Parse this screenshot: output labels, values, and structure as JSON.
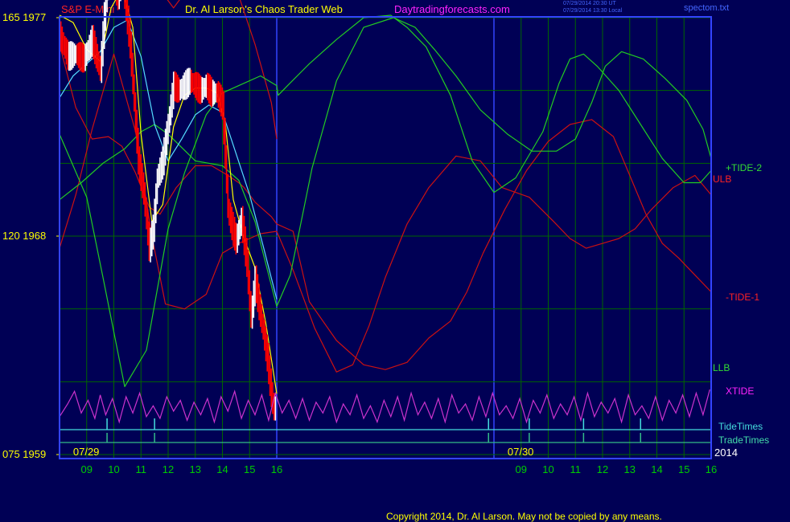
{
  "header": {
    "instrument": "S&P E-Mini",
    "site": "Dr. Al Larson's Chaos Trader Web",
    "url": "Daytradingforecasts.com",
    "stamp_utc": "07/29/2014 20:30 UT",
    "stamp_local": "07/29/2014 13:30 Local",
    "file": "spectom.txt"
  },
  "colors": {
    "background": "#000055",
    "frame": "#3344ff",
    "grid": "#006600",
    "price_up": "#ffffff",
    "price_down": "#ff0000",
    "fast_ma": "#ffff00",
    "slow_ma": "#55ddff",
    "tide_green": "#22cc22",
    "tide_red": "#cc1111",
    "xtide": "#cc33cc",
    "tidetimes": "#44dddd",
    "tradetimes": "#33bb88"
  },
  "labels": {
    "tide2": "+TIDE-2",
    "ulb": "ULB",
    "tide1": "-TIDE-1",
    "llb": "LLB",
    "xtide": "XTIDE",
    "tidetimes": "TideTimes",
    "tradetimes": "TradeTimes",
    "year": "2014",
    "date1": "07/29",
    "date2": "07/30"
  },
  "copyright": "Copyright 2014, Dr. Al Larson. May not be copied by any means.",
  "chart_data": {
    "type": "line",
    "y_axis_labels": [
      {
        "tide": "165",
        "price": "1977"
      },
      {
        "tide": "120",
        "price": "1968"
      },
      {
        "tide": "075",
        "price": "1959"
      }
    ],
    "ylim": [
      1959,
      1977
    ],
    "x_tick_labels": [
      "09",
      "10",
      "11",
      "12",
      "13",
      "14",
      "15",
      "16",
      "09",
      "10",
      "11",
      "12",
      "13",
      "14",
      "15",
      "16"
    ],
    "x_hours": [
      9,
      10,
      11,
      12,
      13,
      14,
      15,
      16,
      25,
      26,
      27,
      28,
      29,
      30,
      31,
      32
    ],
    "xlim": [
      8,
      32
    ],
    "date_labels": [
      {
        "text": "07/29",
        "hour": 8.5
      },
      {
        "text": "07/30",
        "hour": 24.5
      }
    ],
    "price_series": {
      "name": "S&P E-Mini",
      "hours": [
        8,
        8.3,
        8.6,
        8.9,
        9.2,
        9.5,
        9.7,
        9.85,
        10,
        10.15,
        10.3,
        10.45,
        10.6,
        10.75,
        10.9,
        11.1,
        11.3,
        11.45,
        11.6,
        11.8,
        12,
        12.2,
        12.4,
        12.6,
        12.8,
        13,
        13.2,
        13.4,
        13.6,
        13.8,
        14,
        14.1,
        14.2,
        14.35,
        14.5,
        14.7,
        14.9,
        15.05,
        15.2,
        15.35,
        15.5,
        15.65,
        15.8,
        15.9,
        16
      ],
      "values": [
        1976.3,
        1975.4,
        1975.5,
        1975.3,
        1976.1,
        1974.8,
        1977.8,
        1979.1,
        1978.5,
        1977.9,
        1978.7,
        1977.4,
        1975.9,
        1973.5,
        1971.1,
        1969.8,
        1967.5,
        1968.3,
        1970.4,
        1971.1,
        1972.6,
        1974.2,
        1974.0,
        1974.2,
        1974.4,
        1974.2,
        1974.0,
        1974.2,
        1973.9,
        1973.9,
        1973.4,
        1971.3,
        1969.1,
        1968.4,
        1967.8,
        1968.7,
        1966.9,
        1964.6,
        1966.2,
        1965.1,
        1964.1,
        1963.0,
        1961.5,
        1960.8,
        1961.2
      ]
    },
    "fast_ma": {
      "hours": [
        8,
        8.5,
        9,
        9.5,
        9.9,
        10.3,
        10.7,
        11,
        11.4,
        11.8,
        12.2,
        12.6,
        13,
        13.4,
        13.8,
        14.1,
        14.4,
        14.8,
        15.2,
        15.6,
        16
      ],
      "values": [
        1977.1,
        1976.8,
        1975.7,
        1975.2,
        1977.4,
        1978.2,
        1976.6,
        1972.2,
        1968.6,
        1969.3,
        1972.5,
        1973.8,
        1974.1,
        1974.1,
        1973.9,
        1972.7,
        1969.5,
        1967.9,
        1966.7,
        1964.4,
        1961.5
      ]
    },
    "slow_ma": {
      "hours": [
        8,
        8.5,
        9,
        9.5,
        10,
        10.5,
        11,
        11.5,
        12,
        12.5,
        13,
        13.5,
        14,
        14.5,
        15,
        15.5,
        16
      ],
      "values": [
        1973.7,
        1974.6,
        1975.1,
        1975.6,
        1976.6,
        1976.9,
        1975.4,
        1972.6,
        1971.1,
        1972.0,
        1973.0,
        1973.4,
        1973.1,
        1971.4,
        1969.7,
        1967.6,
        1965.4
      ]
    },
    "tide_green_1": {
      "hours": [
        8,
        9,
        9.6,
        10.4,
        11.2,
        12,
        12.6,
        13.4,
        14,
        14.6,
        15.4,
        16,
        16.05,
        16.4,
        17.2,
        18.2,
        19.2,
        20.2,
        20.8,
        21.5,
        22.4,
        23.2,
        24,
        24.8,
        25.8,
        26.4,
        26.8,
        27.3,
        27.8,
        28.6,
        29.4,
        30.2,
        31,
        31.6,
        32
      ],
      "values": [
        1972.2,
        1969.6,
        1966.3,
        1961.8,
        1963.3,
        1968.3,
        1970.6,
        1973.0,
        1973.9,
        1974.2,
        1974.6,
        1974.2,
        1973.8,
        1974.2,
        1975.1,
        1976.1,
        1977.0,
        1977.1,
        1976.6,
        1975.8,
        1973.8,
        1971.1,
        1969.8,
        1970.4,
        1972.3,
        1974.3,
        1975.3,
        1975.5,
        1975.0,
        1974.0,
        1972.6,
        1971.2,
        1970.2,
        1970.2,
        1970.7
      ]
    },
    "tide_green_2": {
      "hours": [
        8,
        8.8,
        9.6,
        10.4,
        11,
        11.5,
        12,
        13,
        14,
        14.6,
        15.2,
        16,
        16.5,
        17.3,
        18.2,
        19.2,
        20.3,
        21.1,
        21.8,
        22.6,
        23.5,
        24.5,
        25.4,
        26.3,
        27,
        27.6,
        28.1,
        28.7,
        29.5,
        30.3,
        31.1,
        31.7,
        32
      ],
      "values": [
        1969.5,
        1970.2,
        1971.0,
        1971.6,
        1972.3,
        1972.6,
        1972.2,
        1971.1,
        1970.9,
        1970.3,
        1968.6,
        1965.1,
        1966.4,
        1970.8,
        1974.4,
        1976.6,
        1977.0,
        1976.6,
        1975.7,
        1974.6,
        1973.2,
        1972.2,
        1971.5,
        1971.5,
        1972.0,
        1973.5,
        1975.0,
        1975.6,
        1975.3,
        1974.5,
        1973.6,
        1972.4,
        1971.2
      ]
    },
    "tide_red_1": {
      "hours": [
        8,
        8.5,
        9,
        9.5,
        10,
        10.6,
        11,
        11.6,
        12.2,
        12.8,
        13.4,
        14,
        14.6,
        15.2,
        15.8,
        16
      ],
      "values": [
        1978.5,
        1979.0,
        1979.1,
        1979.6,
        1980.0,
        1980.2,
        1979.9,
        1978.3,
        1977.4,
        1978.3,
        1978.8,
        1978.8,
        1977.9,
        1975.9,
        1973.5,
        1972.0
      ]
    },
    "tide_red_2": {
      "hours": [
        8,
        8.6,
        9.2,
        10,
        10.8,
        11.4,
        11.9,
        12.6,
        13.4,
        14,
        14.6,
        15.4,
        16,
        16.6,
        17.4,
        18.2,
        18.8,
        19.4,
        20,
        20.8,
        21.6,
        22.6,
        23.5,
        24.3,
        24.8,
        25.3,
        26.2,
        26.8,
        27.4,
        28,
        28.6,
        29.2,
        29.8,
        30.6,
        31.4,
        32
      ],
      "values": [
        1967.5,
        1969.7,
        1972.4,
        1975.5,
        1972.3,
        1968.0,
        1965.2,
        1965.0,
        1965.6,
        1967.3,
        1967.7,
        1968.1,
        1968.2,
        1966.6,
        1964.2,
        1962.4,
        1962.7,
        1964.3,
        1966.3,
        1968.5,
        1970.0,
        1971.3,
        1971.1,
        1970.0,
        1969.8,
        1969.6,
        1968.6,
        1967.9,
        1967.5,
        1967.7,
        1967.9,
        1968.3,
        1969.1,
        1970.0,
        1970.5,
        1969.7
      ]
    },
    "tide_red_3": {
      "hours": [
        8,
        8.6,
        9.2,
        9.8,
        10.3,
        10.8,
        11.3,
        11.7,
        12.3,
        13,
        13.6,
        14.2,
        14.6,
        14.8,
        15.2,
        15.8,
        16,
        16.6,
        17.2,
        18.2,
        19.2,
        20,
        20.8,
        21.6,
        22.4,
        23,
        23.6,
        24.4,
        25.2,
        26,
        26.8,
        27.6,
        28.4,
        29,
        29.6,
        30.2,
        30.8,
        31.4,
        32
      ],
      "values": [
        1975.9,
        1973.3,
        1972.0,
        1972.1,
        1971.7,
        1970.6,
        1969.2,
        1968.9,
        1970.0,
        1970.9,
        1970.9,
        1970.5,
        1970.2,
        1970.0,
        1969.4,
        1968.8,
        1968.5,
        1968.2,
        1965.3,
        1963.7,
        1962.7,
        1962.5,
        1962.8,
        1963.8,
        1964.5,
        1965.7,
        1967.3,
        1969.1,
        1970.7,
        1971.9,
        1972.6,
        1972.8,
        1972.1,
        1970.5,
        1968.9,
        1967.7,
        1967.1,
        1966.4,
        1965.7
      ]
    },
    "xtide": {
      "hours": [
        8,
        8.3,
        8.55,
        8.8,
        9.05,
        9.3,
        9.5,
        9.7,
        9.95,
        10.2,
        10.45,
        10.7,
        10.95,
        11.2,
        11.45,
        11.7,
        11.95,
        12.2,
        12.45,
        12.7,
        12.95,
        13.2,
        13.45,
        13.7,
        13.95,
        14.2,
        14.45,
        14.7,
        14.95,
        15.2,
        15.45,
        15.7,
        15.95,
        16.2,
        16.45,
        16.7,
        16.95,
        17.2,
        17.45,
        17.7,
        17.95,
        18.2,
        18.45,
        18.7,
        18.95,
        19.2,
        19.45,
        19.7,
        19.95,
        20.2,
        20.45,
        20.7,
        20.95,
        21.2,
        21.45,
        21.7,
        21.95,
        22.2,
        22.45,
        22.7,
        22.95,
        23.2,
        23.45,
        23.7,
        23.95,
        24.2,
        24.45,
        24.7,
        24.95,
        25.2,
        25.45,
        25.7,
        25.95,
        26.2,
        26.45,
        26.7,
        26.95,
        27.2,
        27.45,
        27.7,
        27.95,
        28.2,
        28.45,
        28.7,
        28.95,
        29.2,
        29.45,
        29.7,
        29.95,
        30.2,
        30.45,
        30.7,
        30.95,
        31.2,
        31.45,
        31.7,
        31.95
      ],
      "values": [
        0.25,
        0.6,
        0.95,
        0.35,
        0.7,
        0.2,
        0.85,
        0.3,
        0.75,
        0.1,
        0.8,
        0.35,
        0.9,
        0.25,
        0.55,
        0.2,
        0.8,
        0.4,
        0.7,
        0.15,
        0.65,
        0.3,
        0.75,
        0.1,
        0.8,
        0.4,
        0.95,
        0.2,
        0.7,
        0.3,
        0.85,
        0.15,
        0.9,
        0.35,
        0.7,
        0.2,
        0.75,
        0.15,
        0.65,
        0.35,
        0.8,
        0.1,
        0.6,
        0.3,
        0.85,
        0.2,
        0.55,
        0.1,
        0.7,
        0.25,
        0.8,
        0.15,
        0.9,
        0.3,
        0.65,
        0.2,
        0.75,
        0.1,
        0.85,
        0.35,
        0.6,
        0.15,
        0.8,
        0.25,
        0.9,
        0.3,
        0.55,
        0.2,
        0.75,
        0.1,
        0.7,
        0.35,
        0.85,
        0.2,
        0.6,
        0.3,
        0.8,
        0.15,
        0.9,
        0.25,
        0.65,
        0.35,
        0.75,
        0.1,
        0.85,
        0.3,
        0.55,
        0.2,
        0.8,
        0.15,
        0.7,
        0.35,
        0.85,
        0.25,
        0.9,
        0.3,
        1.0
      ]
    },
    "tide_times": [
      9.75,
      11.5,
      23.8,
      25.3,
      27.3,
      29.4
    ],
    "trade_times": [
      9.75,
      11.5,
      23.8,
      25.3,
      27.3,
      29.4
    ]
  }
}
